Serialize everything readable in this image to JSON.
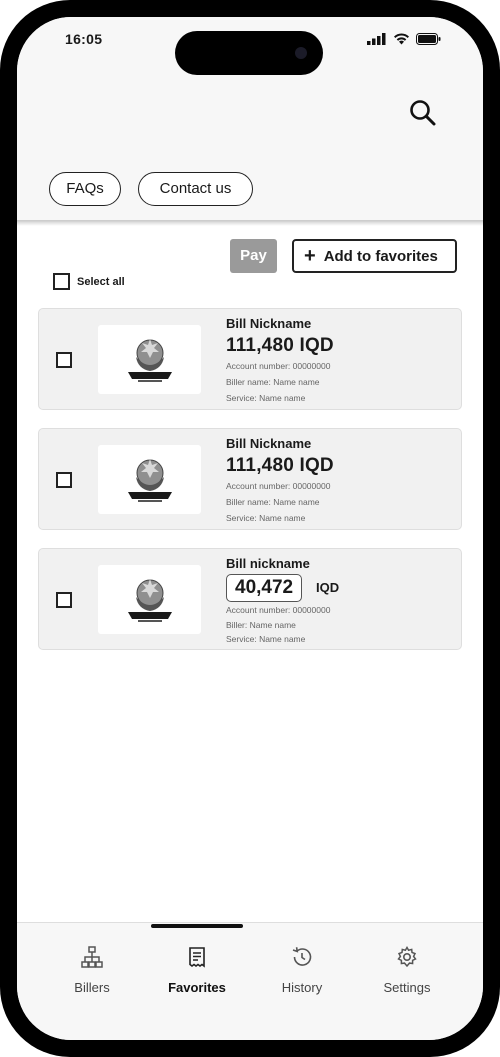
{
  "status_bar": {
    "time": "16:05"
  },
  "header": {
    "chips": [
      {
        "label": "FAQs"
      },
      {
        "label": "Contact us"
      }
    ]
  },
  "actions": {
    "pay_label": "Pay",
    "add_favorites_label": "Add to favorites",
    "select_all_label": "Select all"
  },
  "bills": [
    {
      "nickname": "Bill Nickname",
      "amount": "111,480 IQD",
      "line1": "Account number: 00000000",
      "line2": "Biller name: Name name",
      "line3": "Service: Name name"
    },
    {
      "nickname": "Bill Nickname",
      "amount": "111,480 IQD",
      "line1": "Account number: 00000000",
      "line2": "Biller name: Name name",
      "line3": "Service: Name name"
    },
    {
      "nickname": "Bill nickname",
      "amount": "40,472",
      "unit": "IQD",
      "line1": "Account number: 00000000",
      "line2": "Biller: Name name",
      "line3": "Service: Name name"
    }
  ],
  "tabs": [
    {
      "label": "Billers",
      "icon": "sitemap-icon"
    },
    {
      "label": "Favorites",
      "icon": "receipt-icon",
      "active": true
    },
    {
      "label": "History",
      "icon": "history-icon"
    },
    {
      "label": "Settings",
      "icon": "gear-icon"
    }
  ]
}
